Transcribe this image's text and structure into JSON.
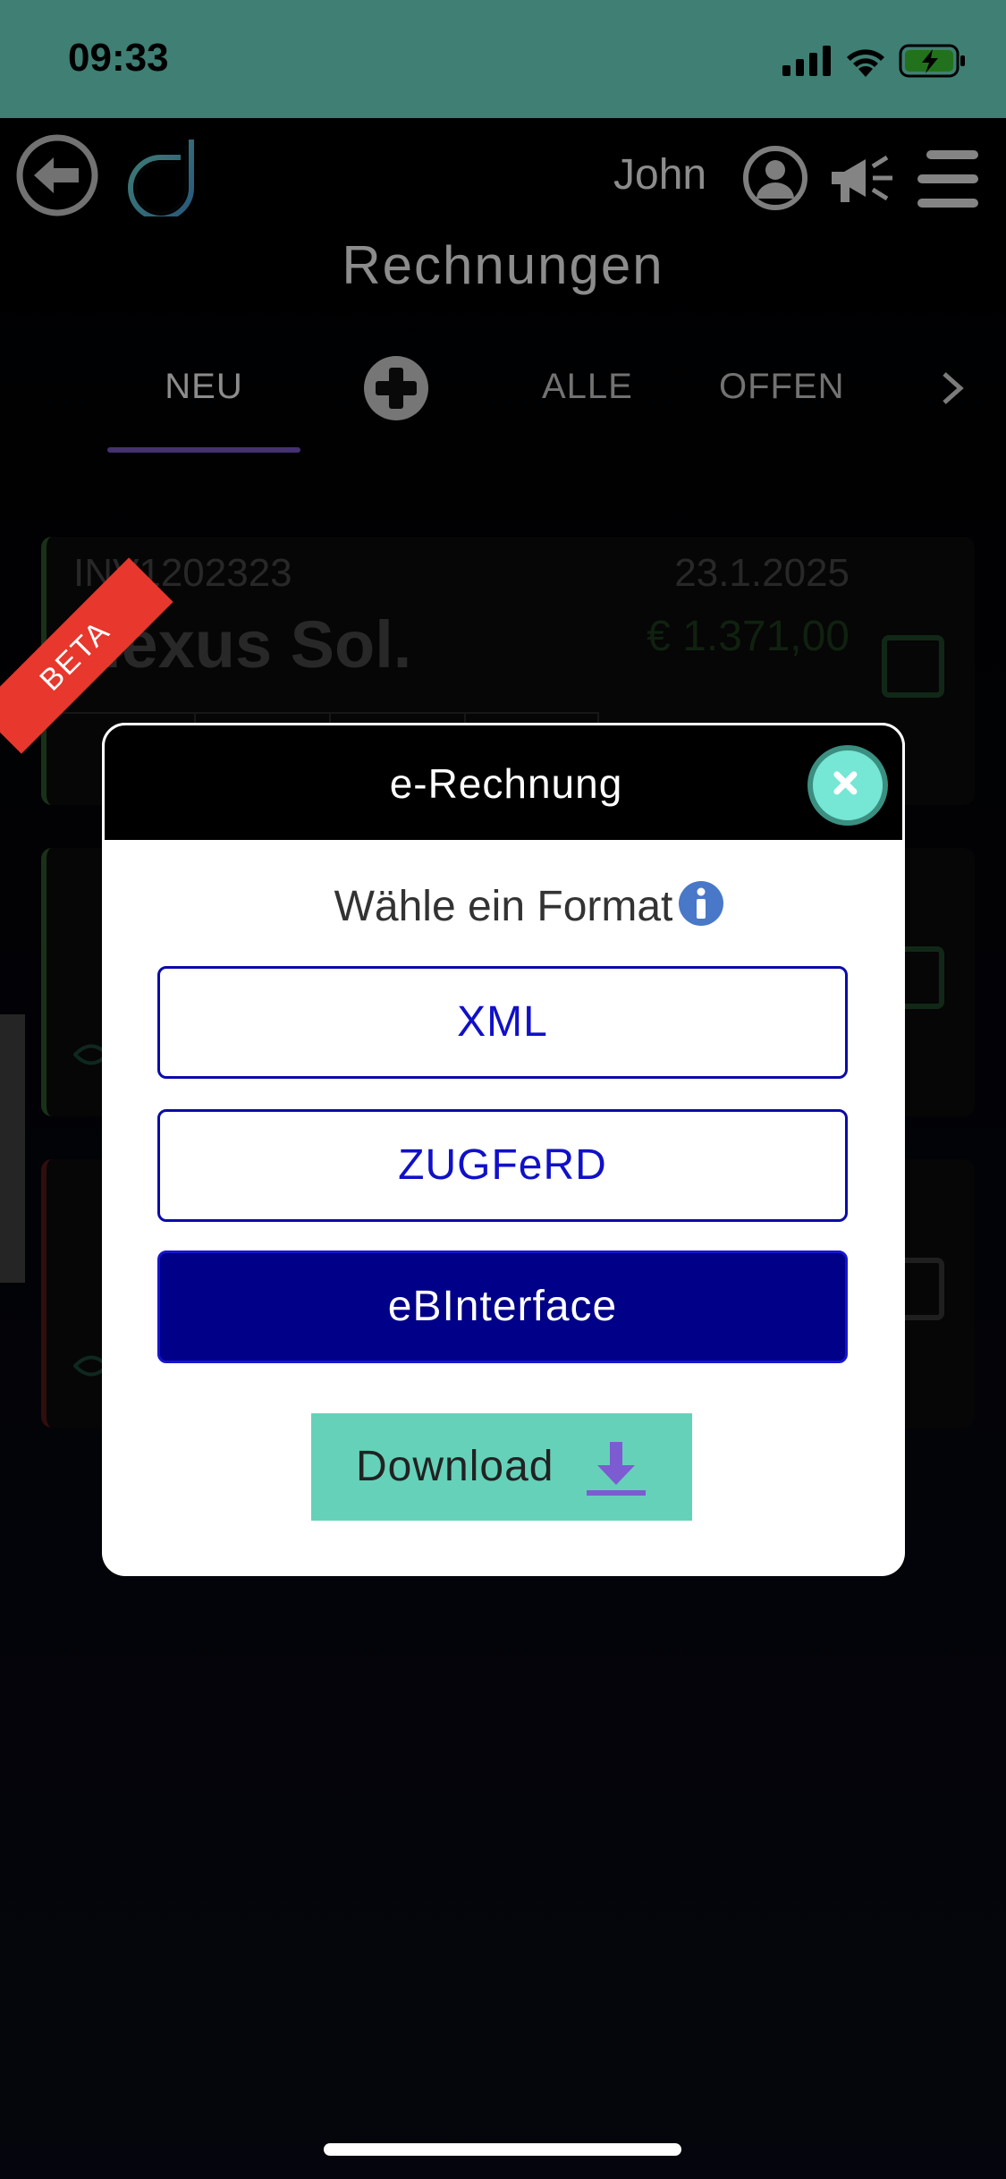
{
  "status_bar": {
    "time": "09:33"
  },
  "header": {
    "user_name": "John",
    "title": "Rechnungen"
  },
  "tabs": [
    {
      "label": "NEU",
      "active": true
    },
    {
      "label": "ALLE"
    },
    {
      "label": "OFFEN"
    }
  ],
  "invoices": [
    {
      "number": "INV1202323",
      "date": "23.1.2025",
      "customer": "Nexus Sol.",
      "amount": "€ 1.371,00"
    }
  ],
  "modal": {
    "badge": "BETA",
    "title": "e-Rechnung",
    "prompt": "Wähle ein Format",
    "formats": [
      "XML",
      "ZUGFeRD",
      "eBInterface"
    ],
    "selected_format": "eBInterface",
    "download_label": "Download"
  },
  "colors": {
    "accent": "#75e7d4",
    "tab_underline": "#7d5bd1",
    "format_border": "#0b0ba8",
    "format_selected_bg": "#000088",
    "download_bg": "#66d1b9",
    "beta_badge": "#e8372c",
    "info_icon": "#4a78c8"
  }
}
